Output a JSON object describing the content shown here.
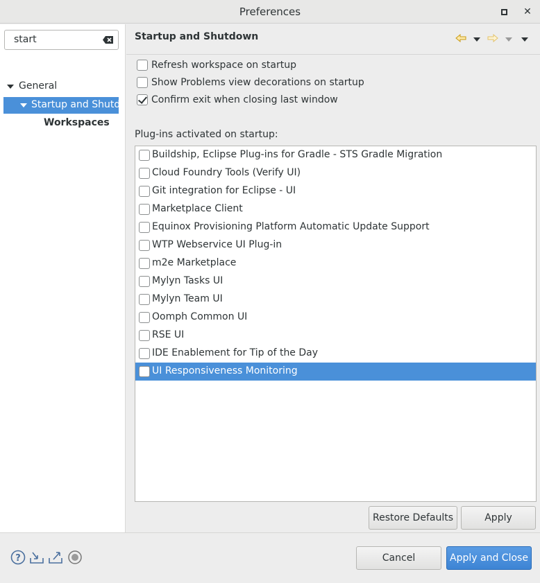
{
  "window": {
    "title": "Preferences"
  },
  "filter": {
    "value": "start"
  },
  "tree": {
    "general": "General",
    "startup": "Startup and Shutdown",
    "workspaces": "Workspaces"
  },
  "page": {
    "title": "Startup and Shutdown"
  },
  "options": [
    {
      "label": "Refresh workspace on startup",
      "checked": false
    },
    {
      "label": "Show Problems view decorations on startup",
      "checked": false
    },
    {
      "label": "Confirm exit when closing last window",
      "checked": true
    }
  ],
  "plugins_caption": "Plug-ins activated on startup:",
  "plugins": [
    {
      "label": "Buildship, Eclipse Plug-ins for Gradle - STS Gradle Migration",
      "checked": false
    },
    {
      "label": "Cloud Foundry Tools (Verify UI)",
      "checked": false
    },
    {
      "label": "Git integration for Eclipse - UI",
      "checked": false
    },
    {
      "label": "Marketplace Client",
      "checked": false
    },
    {
      "label": "Equinox Provisioning Platform Automatic Update Support",
      "checked": false
    },
    {
      "label": "WTP Webservice UI Plug-in",
      "checked": false
    },
    {
      "label": "m2e Marketplace",
      "checked": false
    },
    {
      "label": "Mylyn Tasks UI",
      "checked": false
    },
    {
      "label": "Mylyn Team UI",
      "checked": false
    },
    {
      "label": "Oomph Common UI",
      "checked": false
    },
    {
      "label": "RSE UI",
      "checked": false
    },
    {
      "label": "IDE Enablement for Tip of the Day",
      "checked": false
    },
    {
      "label": "UI Responsiveness Monitoring",
      "checked": false,
      "selected": true
    }
  ],
  "buttons": {
    "restore_defaults": "Restore Defaults",
    "apply": "Apply",
    "cancel": "Cancel",
    "apply_and_close": "Apply and Close"
  },
  "colors": {
    "selection": "#4a90d9",
    "nav_arrow": "#e8a317"
  },
  "footer_icons": [
    "help-icon",
    "import-icon",
    "export-icon",
    "record-icon"
  ]
}
